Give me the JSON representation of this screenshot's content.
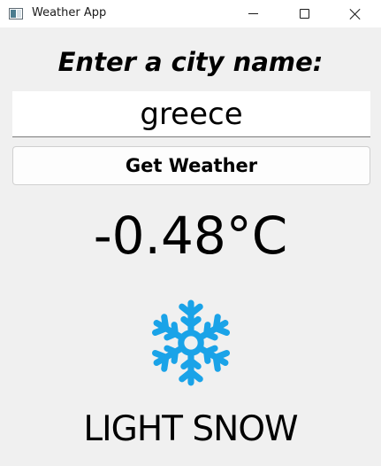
{
  "window": {
    "title": "Weather App"
  },
  "prompt": {
    "label": "Enter a city name:"
  },
  "city_input": {
    "value": "greece"
  },
  "get_weather_button": {
    "label": "Get Weather"
  },
  "weather": {
    "temperature": "-0.48°C",
    "icon": "snowflake-icon",
    "icon_color": "#1aa3e8",
    "description": "LIGHT SNOW"
  }
}
